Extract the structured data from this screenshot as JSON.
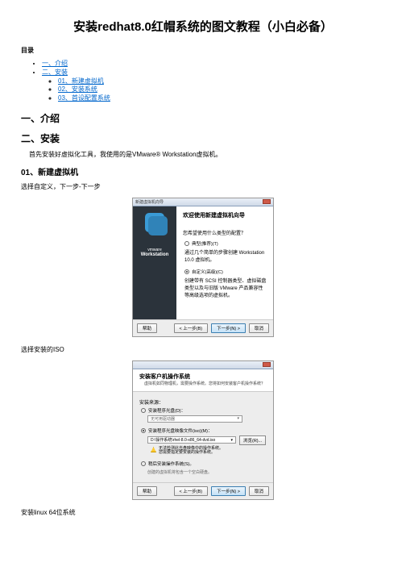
{
  "title": "安装redhat8.0红帽系统的图文教程（小白必备）",
  "toc_label": "目录",
  "toc": {
    "l1a": "一、介绍",
    "l1b": "二、安装",
    "l2a": "01、新建虚拟机",
    "l2b": "02、安装系统",
    "l2c": "03、首设配置系统"
  },
  "s1": {
    "h": "一、介绍"
  },
  "s2": {
    "h": "二、安装",
    "intro": "首先安装好虚拟化工具，我使用的是VMware® Workstation虚拟机。"
  },
  "s2_1": {
    "h": "01、新建虚拟机",
    "step1": "选择自定义，下一步-下一步",
    "step2": "选择安装的ISO",
    "step3": "安装linux 64位系统"
  },
  "shot1": {
    "win_title": "新建虚拟机向导",
    "heading": "欢迎使用新建虚拟机向导",
    "brand_top": "vmware",
    "brand_main": "Workstation",
    "q": "您希望使用什么类型的配置？",
    "r1_label": "典型(推荐)(T)",
    "r1_desc": "通过几个简单的步骤创建 Workstation 10.0 虚拟机。",
    "r2_label": "自定义(高级)(C)",
    "r2_desc": "创建带有 SCSI 控制器类型、虚拟磁盘类型以及与旧版 VMware 产品兼容性等高级选项的虚拟机。",
    "btn_help": "帮助",
    "btn_back": "< 上一步(B)",
    "btn_next": "下一步(N) >",
    "btn_cancel": "取消"
  },
  "shot2": {
    "h_title": "安装客户机操作系统",
    "h_desc": "虚拟机如同物理机，需要操作系统。您将如何安装客户机操作系统？",
    "grp": "安装来源：",
    "r1": "安装程序光盘(D)：",
    "drive_placeholder": "无可用驱动器",
    "r2": "安装程序光盘映像文件(iso)(M)：",
    "iso_value": "D:\\操作系统\\rhel-8.0-x86_64-dvd.iso",
    "browse": "浏览(R)...",
    "warn1": "无法检测此光盘映像中的操作系统。",
    "warn2": "您需要指定要安装的操作系统。",
    "r3": "稍后安装操作系统(S)。",
    "note": "创建的虚拟机将包含一个空白硬盘。",
    "btn_help": "帮助",
    "btn_back": "< 上一步(B)",
    "btn_next": "下一步(N) >",
    "btn_cancel": "取消"
  }
}
